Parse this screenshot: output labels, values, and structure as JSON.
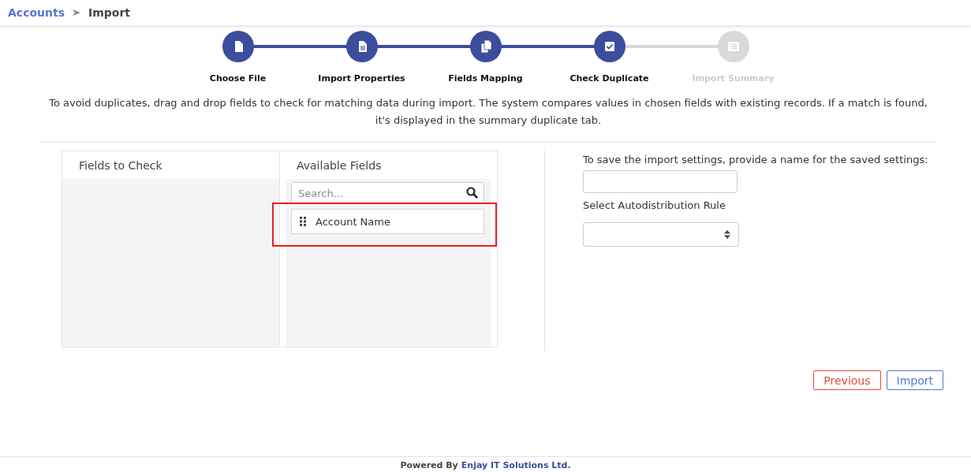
{
  "breadcrumb": [
    {
      "label": "Accounts",
      "kind": "link"
    },
    {
      "label": "Import",
      "kind": "current"
    }
  ],
  "steps": [
    {
      "label": "Choose File",
      "kind": "file",
      "done": true
    },
    {
      "label": "Import Properties",
      "kind": "doc",
      "done": true
    },
    {
      "label": "Fields Mapping",
      "kind": "copy",
      "done": true
    },
    {
      "label": "Check Duplicate",
      "kind": "check",
      "done": true
    },
    {
      "label": "Import Summary",
      "kind": "list",
      "done": false
    }
  ],
  "description": "To avoid duplicates, drag and drop fields to check for matching data during import. The system compares values in chosen fields with existing records. If a match is found, it's displayed in the summary duplicate tab.",
  "fields_to_check": {
    "title": "Fields to Check"
  },
  "available_fields": {
    "title": "Available Fields",
    "search": {
      "placeholder": "Search..."
    },
    "items": [
      {
        "label": "Account Name",
        "highlighted": true
      }
    ]
  },
  "settings": {
    "name_label": "To save the import settings, provide a name for the saved settings:",
    "rule_label": "Select Autodistribution Rule"
  },
  "buttons": [
    {
      "label": "Previous",
      "kind": "secondary"
    },
    {
      "label": "Import",
      "kind": "primary"
    }
  ],
  "footer": {
    "prefix": "Powered By",
    "company": "Enjay IT Solutions Ltd."
  }
}
